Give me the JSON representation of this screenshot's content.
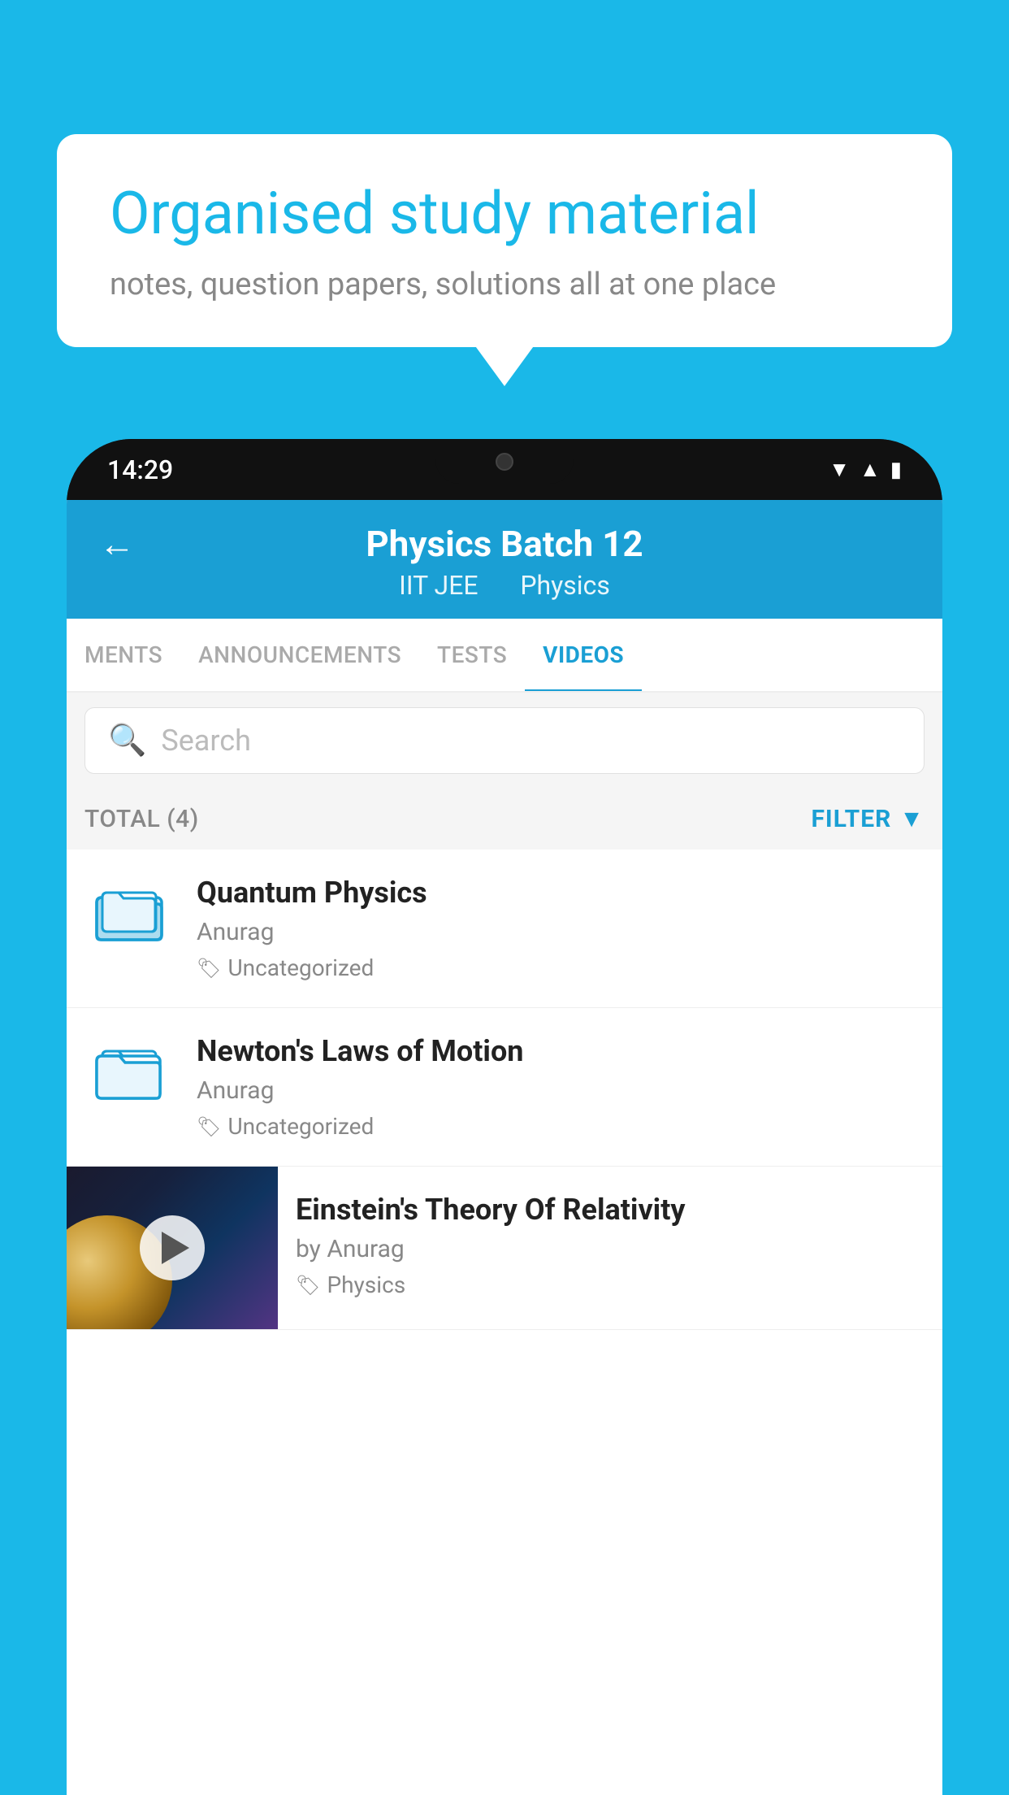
{
  "background_color": "#1ab8e8",
  "speech_bubble": {
    "title": "Organised study material",
    "subtitle": "notes, question papers, solutions all at one place"
  },
  "phone": {
    "time": "14:29",
    "status_icons": [
      "wifi",
      "signal",
      "battery"
    ]
  },
  "app": {
    "header": {
      "title": "Physics Batch 12",
      "subtitle_part1": "IIT JEE",
      "subtitle_part2": "Physics",
      "back_label": "←"
    },
    "tabs": [
      {
        "label": "MENTS",
        "active": false
      },
      {
        "label": "ANNOUNCEMENTS",
        "active": false
      },
      {
        "label": "TESTS",
        "active": false
      },
      {
        "label": "VIDEOS",
        "active": true
      }
    ],
    "search": {
      "placeholder": "Search"
    },
    "filter_bar": {
      "total_label": "TOTAL (4)",
      "filter_label": "FILTER"
    },
    "videos": [
      {
        "id": 1,
        "title": "Quantum Physics",
        "author": "Anurag",
        "tag": "Uncategorized",
        "type": "folder"
      },
      {
        "id": 2,
        "title": "Newton's Laws of Motion",
        "author": "Anurag",
        "tag": "Uncategorized",
        "type": "folder"
      },
      {
        "id": 3,
        "title": "Einstein's Theory Of Relativity",
        "author": "by Anurag",
        "tag": "Physics",
        "type": "video"
      }
    ]
  }
}
